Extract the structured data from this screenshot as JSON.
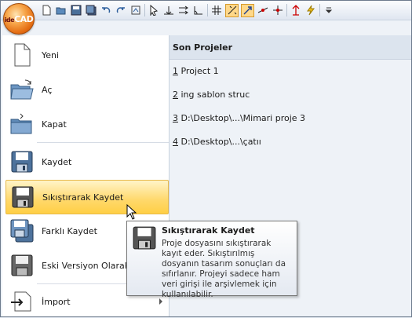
{
  "app": {
    "logo_prefix": "ide",
    "logo_text": "CAD"
  },
  "toolbar": {
    "icons": [
      "new-file-icon",
      "open-folder-icon",
      "save-icon",
      "save-all-icon",
      "undo-icon",
      "redo-icon",
      "refresh-icon",
      "select-cursor-icon",
      "dimension-icon",
      "move-icon",
      "angle-icon",
      "grid-icon",
      "snap-icon",
      "snap-arrow-icon",
      "line-snap-icon",
      "cross-snap-icon",
      "ortho-icon",
      "lightning-icon",
      "dropdown-icon"
    ]
  },
  "menu": {
    "items": [
      {
        "label": "Yeni",
        "icon": "new-document-icon"
      },
      {
        "label": "Aç",
        "icon": "open-folder-icon"
      },
      {
        "label": "Kapat",
        "icon": "close-folder-icon"
      },
      {
        "label": "Kaydet",
        "icon": "save-icon"
      },
      {
        "label": "Sıkıştırarak Kaydet",
        "icon": "compress-save-icon"
      },
      {
        "label": "Farklı Kaydet",
        "icon": "save-as-icon"
      },
      {
        "label": "Eski Versiyon Olarak K",
        "icon": "save-old-version-icon"
      },
      {
        "label": "İmport",
        "icon": "import-icon"
      }
    ],
    "highlighted_index": 4
  },
  "recent": {
    "title": "Son Projeler",
    "items": [
      {
        "num": "1",
        "text": " Project 1"
      },
      {
        "num": "2",
        "text": " ing sablon struc"
      },
      {
        "num": "3",
        "text": " D:\\Desktop\\...\\Mimari proje 3"
      },
      {
        "num": "4",
        "text": " D:\\Desktop\\...\\çatıı"
      }
    ]
  },
  "tooltip": {
    "title": "Sıkıştırarak Kaydet",
    "body": "Proje dosyasını sıkıştırarak kayıt eder. Sıkıştırılmış dosyanın tasarım sonuçları da sıfırlanır. Projeyi sadece ham veri girişi ile arşivlemek için kullanılabilir."
  }
}
